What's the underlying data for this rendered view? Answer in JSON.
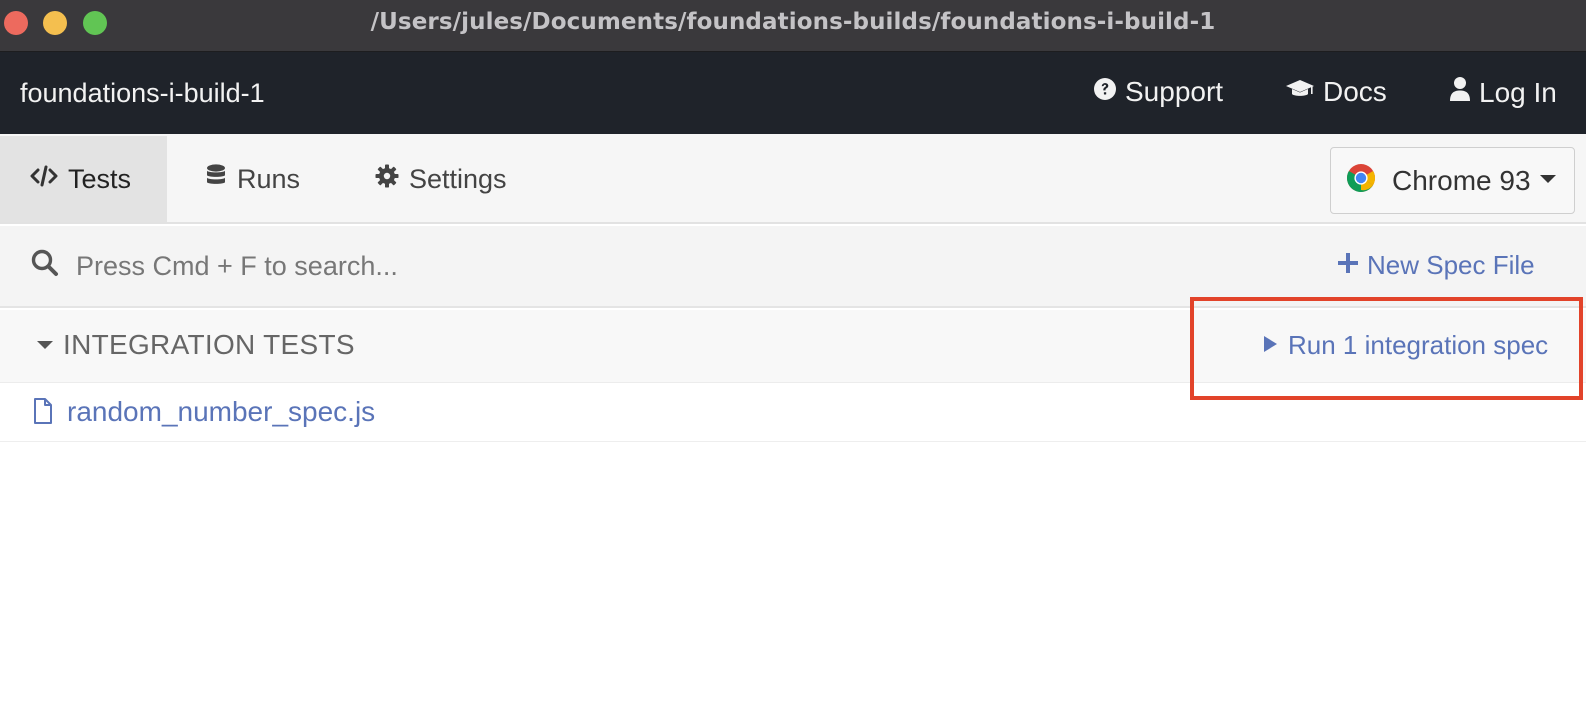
{
  "window": {
    "title": "/Users/jules/Documents/foundations-builds/foundations-i-build-1"
  },
  "header": {
    "project_name": "foundations-i-build-1",
    "links": {
      "support": "Support",
      "docs": "Docs",
      "login": "Log In"
    }
  },
  "nav": {
    "tabs": [
      {
        "label": "Tests",
        "icon": "code-icon",
        "active": true
      },
      {
        "label": "Runs",
        "icon": "database-icon",
        "active": false
      },
      {
        "label": "Settings",
        "icon": "gear-icon",
        "active": false
      }
    ],
    "browser": {
      "label": "Chrome 93",
      "icon": "chrome-icon"
    }
  },
  "search": {
    "placeholder": "Press Cmd + F to search...",
    "value": ""
  },
  "actions": {
    "new_spec_label": "New Spec File"
  },
  "integration": {
    "title": "INTEGRATION TESTS",
    "run_label": "Run 1 integration spec",
    "specs": [
      {
        "name": "random_number_spec.js"
      }
    ]
  },
  "colors": {
    "link": "#5a74b8",
    "header_bg": "#1f232a",
    "titlebar_bg": "#3a393c",
    "highlight": "#e2432a"
  }
}
